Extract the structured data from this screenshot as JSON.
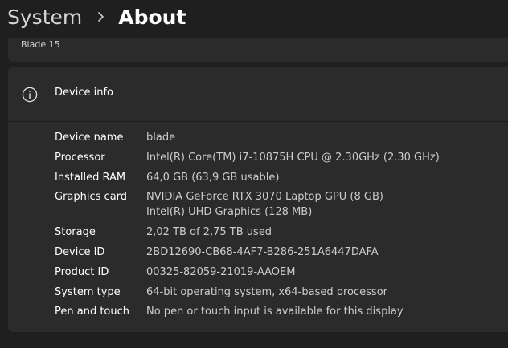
{
  "breadcrumb": {
    "parent": "System",
    "current": "About",
    "separator_icon": "chevron-right-icon"
  },
  "top_card": {
    "label": "Blade 15"
  },
  "device_info": {
    "icon": "info-icon",
    "title": "Device info",
    "specs": [
      {
        "label": "Device name",
        "values": [
          "blade"
        ]
      },
      {
        "label": "Processor",
        "values": [
          "Intel(R) Core(TM) i7-10875H CPU @ 2.30GHz (2.30 GHz)"
        ]
      },
      {
        "label": "Installed RAM",
        "values": [
          "64,0 GB (63,9 GB usable)"
        ]
      },
      {
        "label": "Graphics card",
        "values": [
          "NVIDIA GeForce RTX 3070 Laptop GPU (8 GB)",
          "Intel(R) UHD Graphics (128 MB)"
        ]
      },
      {
        "label": "Storage",
        "values": [
          "2,02 TB of 2,75 TB used"
        ]
      },
      {
        "label": "Device ID",
        "values": [
          "2BD12690-CB68-4AF7-B286-251A6447DAFA"
        ]
      },
      {
        "label": "Product ID",
        "values": [
          "00325-82059-21019-AAOEM"
        ]
      },
      {
        "label": "System type",
        "values": [
          "64-bit operating system, x64-based processor"
        ]
      },
      {
        "label": "Pen and touch",
        "values": [
          "No pen or touch input is available for this display"
        ]
      }
    ]
  },
  "colors": {
    "background": "#1f1f1f",
    "card": "#2b2b2b",
    "text_primary": "#ffffff",
    "text_secondary": "#cccccc"
  }
}
